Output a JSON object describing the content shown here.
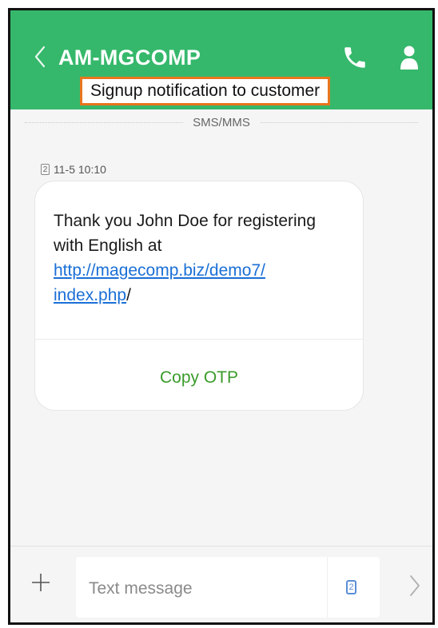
{
  "header": {
    "contact_name": "AM-MGCOMP",
    "back_icon": "chevron-left-icon",
    "call_icon": "phone-icon",
    "profile_icon": "person-icon",
    "color": "#35b86b"
  },
  "banner": {
    "text": "Signup notification to customer",
    "border_color": "#e8761e"
  },
  "divider": {
    "label": "SMS/MMS"
  },
  "message": {
    "sim": "2",
    "timestamp": "11-5 10:10",
    "text_before_link": "Thank you John Doe for registering with English at ",
    "link_part1": "http://magecomp.biz/demo7/",
    "link_part2": "index.php",
    "text_after_link": "/",
    "action_label": "Copy OTP"
  },
  "composer": {
    "placeholder": "Text message",
    "sim": "2",
    "add_icon": "plus-icon",
    "send_icon": "chevron-right-icon"
  }
}
